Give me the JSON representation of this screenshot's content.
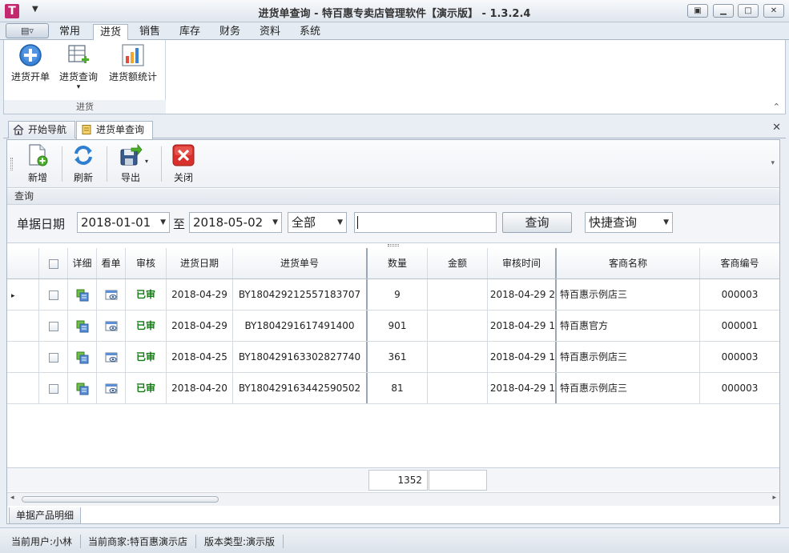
{
  "window": {
    "title": "进货单查询 - 特百惠专卖店管理软件【演示版】 - 1.3.2.4",
    "logo": "T",
    "quick_access_arrow": "▼",
    "app_menu_icon": "▤▿",
    "controls": [
      "▣",
      "▁",
      "□",
      "✕"
    ]
  },
  "ribbon": {
    "tabs": [
      "常用",
      "进货",
      "销售",
      "库存",
      "财务",
      "资料",
      "系统"
    ],
    "active_tab": "进货",
    "group_label": "进货",
    "buttons": [
      {
        "label": "进货开单",
        "icon": "add-circle-icon"
      },
      {
        "label": "进货查询",
        "icon": "table-search-icon",
        "dropdown": "▾"
      },
      {
        "label": "进货额统计",
        "icon": "bar-chart-icon"
      }
    ],
    "collapse_glyph": "⌃"
  },
  "doc_tabs": {
    "tabs": [
      {
        "label": "开始导航",
        "icon": "home-icon"
      },
      {
        "label": "进货单查询",
        "icon": "note-icon"
      }
    ],
    "close_glyph": "✕"
  },
  "toolbar": {
    "buttons": [
      {
        "label": "新增",
        "icon": "new-doc-icon"
      },
      {
        "label": "刷新",
        "icon": "refresh-icon"
      },
      {
        "label": "导出",
        "icon": "export-icon"
      },
      {
        "label": "关闭",
        "icon": "close-red-icon"
      }
    ],
    "more_glyph": "▾"
  },
  "query": {
    "title": "查询",
    "date_label": "单据日期",
    "date_from": "2018-01-01",
    "to_label": "至",
    "date_to": "2018-05-02",
    "status_value": "全部",
    "keyword_value": "",
    "search_button": "查询",
    "quick_query": "快捷查询",
    "dropdown_arrow": "▼"
  },
  "grid": {
    "columns": [
      "",
      "",
      "详细",
      "看单",
      "审核",
      "进货日期",
      "进货单号",
      "数量",
      "金额",
      "审核时间",
      "客商名称",
      "客商编号"
    ],
    "rows": [
      {
        "pointer": "▸",
        "status": "已审",
        "date": "2018-04-29",
        "no": "BY180429212557183707",
        "qty": "9",
        "amount": "",
        "audit_time": "2018-04-29 2",
        "supplier": "特百惠示例店三",
        "supplier_no": "000003"
      },
      {
        "pointer": "",
        "status": "已审",
        "date": "2018-04-29",
        "no": "BY1804291617491400",
        "qty": "901",
        "amount": "",
        "audit_time": "2018-04-29 1",
        "supplier": "特百惠官方",
        "supplier_no": "000001"
      },
      {
        "pointer": "",
        "status": "已审",
        "date": "2018-04-25",
        "no": "BY180429163302827740",
        "qty": "361",
        "amount": "",
        "audit_time": "2018-04-29 1",
        "supplier": "特百惠示例店三",
        "supplier_no": "000003"
      },
      {
        "pointer": "",
        "status": "已审",
        "date": "2018-04-20",
        "no": "BY180429163442590502",
        "qty": "81",
        "amount": "",
        "audit_time": "2018-04-29 1",
        "supplier": "特百惠示例店三",
        "supplier_no": "000003"
      }
    ],
    "total_qty": "1352",
    "total_amount": ""
  },
  "bottom_tab": "单据产品明细",
  "statusbar": {
    "user": "当前用户:小林",
    "merchant": "当前商家:特百惠演示店",
    "version": "版本类型:演示版"
  },
  "scroll": {
    "left": "◂",
    "right": "▸"
  },
  "colors": {
    "accent": "#c4286e",
    "approved": "#127a12",
    "close_red": "#d8302c"
  }
}
